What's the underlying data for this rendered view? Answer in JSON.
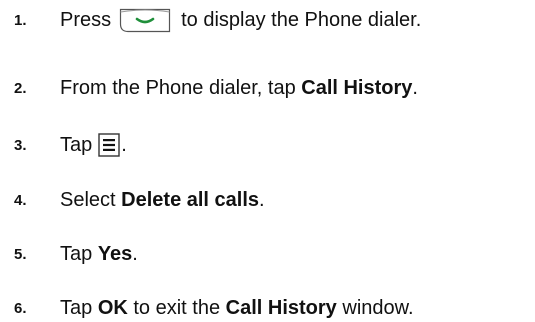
{
  "steps": [
    {
      "number": "1.",
      "before": "Press",
      "icon": "call-key-icon",
      "after": "to display the Phone dialer."
    },
    {
      "number": "2.",
      "before": "From the Phone dialer, tap ",
      "bold": "Call History",
      "after": "."
    },
    {
      "number": "3.",
      "before": "Tap",
      "icon": "menu-icon",
      "after": "."
    },
    {
      "number": "4.",
      "before": "Select ",
      "bold": "Delete all calls",
      "after": "."
    },
    {
      "number": "5.",
      "before": "Tap ",
      "bold": "Yes",
      "after": "."
    },
    {
      "number": "6.",
      "before": "Tap ",
      "bold": "OK",
      "middle": " to exit the ",
      "bold2": "Call History",
      "after": " window."
    }
  ],
  "colors": {
    "call_key_accent": "#1f8f3a",
    "icon_border": "#555555"
  }
}
